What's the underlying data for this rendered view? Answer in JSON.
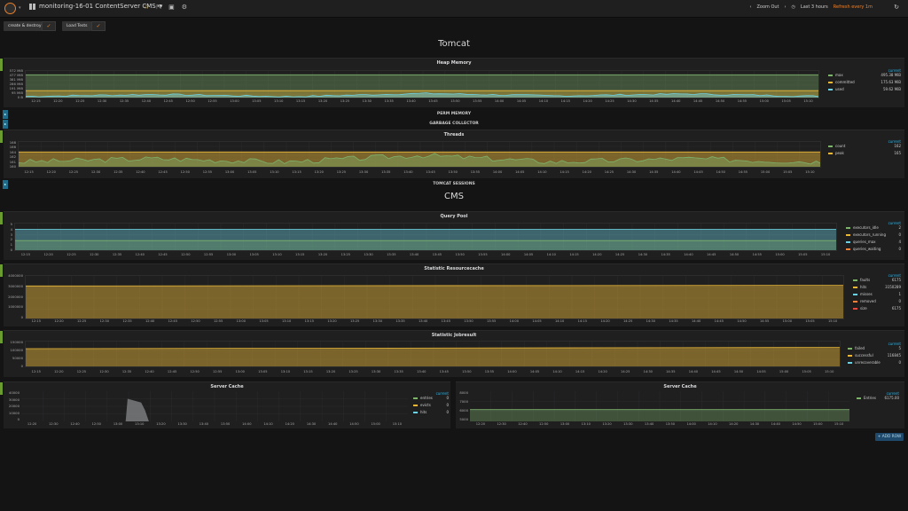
{
  "topbar": {
    "dashboard_title": "monitoring-16-01 ContentServer CMS",
    "title_caret": "▾",
    "logo_caret": "▾",
    "zoom_out": "Zoom Out",
    "time_range": "Last 3 hours",
    "refresh": "Refresh every 1m",
    "icons": [
      "dashboard-grid-icon",
      "star-icon",
      "share-icon",
      "save-icon",
      "settings-icon",
      "clock-icon",
      "refresh-icon"
    ]
  },
  "submenu": {
    "create_destroy": "create & destroy",
    "load_tests": "Load Tests"
  },
  "rows": {
    "tomcat": "Tomcat",
    "cms": "CMS",
    "perm_memory": "PERM MEMORY",
    "garbage_collector": "GARBAGE COLLECTOR",
    "tomcat_sessions": "TOMCAT SESSIONS",
    "add_row": "+ ADD ROW"
  },
  "panels": {
    "heap": {
      "title": "Heap Memory",
      "yticks": [
        "572 MiB",
        "477 MiB",
        "381 MiB",
        "286 MiB",
        "191 MiB",
        "95 MiB",
        "0 B"
      ],
      "xticks": [
        "12:15",
        "12:20",
        "12:25",
        "12:30",
        "12:35",
        "12:40",
        "12:45",
        "12:50",
        "12:55",
        "13:00",
        "13:05",
        "13:10",
        "13:15",
        "13:20",
        "13:25",
        "13:30",
        "13:35",
        "13:40",
        "13:45",
        "13:50",
        "13:55",
        "14:00",
        "14:05",
        "14:10",
        "14:15",
        "14:20",
        "14:25",
        "14:30",
        "14:35",
        "14:40",
        "14:45",
        "14:50",
        "14:55",
        "15:00",
        "15:05",
        "15:10"
      ],
      "legend_header": "current",
      "legend": [
        {
          "name": "max",
          "value": "495.38 MiB",
          "color": "#7eb26d"
        },
        {
          "name": "committed",
          "value": "175.63 MiB",
          "color": "#eab839"
        },
        {
          "name": "used",
          "value": "59.62 MiB",
          "color": "#6ed0e0"
        }
      ]
    },
    "threads": {
      "title": "Threads",
      "yticks": [
        "168",
        "166",
        "164",
        "162",
        "161",
        "160"
      ],
      "xticks": [
        "12:15",
        "12:20",
        "12:25",
        "12:30",
        "12:35",
        "12:40",
        "12:45",
        "12:50",
        "12:55",
        "13:00",
        "13:05",
        "13:10",
        "13:15",
        "13:20",
        "13:25",
        "13:30",
        "13:35",
        "13:40",
        "13:45",
        "13:50",
        "13:55",
        "14:00",
        "14:05",
        "14:10",
        "14:15",
        "14:20",
        "14:25",
        "14:30",
        "14:35",
        "14:40",
        "14:45",
        "14:50",
        "14:55",
        "15:00",
        "15:05",
        "15:10"
      ],
      "legend_header": "current",
      "legend": [
        {
          "name": "count",
          "value": "162",
          "color": "#7eb26d"
        },
        {
          "name": "peak",
          "value": "165",
          "color": "#eab839"
        }
      ]
    },
    "query_pool": {
      "title": "Query Pool",
      "yticks": [
        "5",
        "4",
        "3",
        "2",
        "1",
        "0"
      ],
      "xticks": [
        "12:15",
        "12:20",
        "12:25",
        "12:30",
        "12:35",
        "12:40",
        "12:45",
        "12:50",
        "12:55",
        "13:00",
        "13:05",
        "13:10",
        "13:15",
        "13:20",
        "13:25",
        "13:30",
        "13:35",
        "13:40",
        "13:45",
        "13:50",
        "13:55",
        "14:00",
        "14:05",
        "14:10",
        "14:15",
        "14:20",
        "14:25",
        "14:30",
        "14:35",
        "14:40",
        "14:45",
        "14:50",
        "14:55",
        "15:00",
        "15:05",
        "15:10"
      ],
      "legend_header": "current",
      "legend": [
        {
          "name": "executors_idle",
          "value": "2",
          "color": "#7eb26d"
        },
        {
          "name": "executors_running",
          "value": "0",
          "color": "#eab839"
        },
        {
          "name": "queries_max",
          "value": "4",
          "color": "#6ed0e0"
        },
        {
          "name": "queries_waiting",
          "value": "0",
          "color": "#ef843c"
        }
      ]
    },
    "resourcecache": {
      "title": "Statistic Resourcecache",
      "yticks": [
        "4000000",
        "3000000",
        "2000000",
        "1000000",
        "0"
      ],
      "xticks": [
        "12:15",
        "12:20",
        "12:25",
        "12:30",
        "12:35",
        "12:40",
        "12:45",
        "12:50",
        "12:55",
        "13:00",
        "13:05",
        "13:10",
        "13:15",
        "13:20",
        "13:25",
        "13:30",
        "13:35",
        "13:40",
        "13:45",
        "13:50",
        "13:55",
        "14:00",
        "14:05",
        "14:10",
        "14:15",
        "14:20",
        "14:25",
        "14:30",
        "14:35",
        "14:40",
        "14:45",
        "14:50",
        "14:55",
        "15:00",
        "15:05",
        "15:10"
      ],
      "legend_header": "current",
      "legend": [
        {
          "name": "faults",
          "value": "6175",
          "color": "#7eb26d"
        },
        {
          "name": "hits",
          "value": "3150289",
          "color": "#eab839"
        },
        {
          "name": "misses",
          "value": "1",
          "color": "#6ed0e0"
        },
        {
          "name": "removed",
          "value": "0",
          "color": "#ef843c"
        },
        {
          "name": "size",
          "value": "6175",
          "color": "#e24d42"
        }
      ]
    },
    "jobresult": {
      "title": "Statistic Jobresult",
      "yticks": [
        "150000",
        "100000",
        "50000",
        "0"
      ],
      "xticks": [
        "12:15",
        "12:20",
        "12:25",
        "12:30",
        "12:35",
        "12:40",
        "12:45",
        "12:50",
        "12:55",
        "13:00",
        "13:05",
        "13:10",
        "13:15",
        "13:20",
        "13:25",
        "13:30",
        "13:35",
        "13:40",
        "13:45",
        "13:50",
        "13:55",
        "14:00",
        "14:05",
        "14:10",
        "14:15",
        "14:20",
        "14:25",
        "14:30",
        "14:35",
        "14:40",
        "14:45",
        "14:50",
        "14:55",
        "15:00",
        "15:05",
        "15:10"
      ],
      "legend_header": "current",
      "legend": [
        {
          "name": "failed",
          "value": "5",
          "color": "#7eb26d"
        },
        {
          "name": "successful",
          "value": "116845",
          "color": "#eab839"
        },
        {
          "name": "unrecoverable",
          "value": "0",
          "color": "#6ed0e0"
        }
      ]
    },
    "cache_left": {
      "title": "Server Cache",
      "yticks": [
        "40000",
        "30000",
        "20000",
        "10000",
        "0"
      ],
      "xticks": [
        "12:20",
        "12:30",
        "12:40",
        "12:50",
        "13:00",
        "13:10",
        "13:20",
        "13:30",
        "13:40",
        "13:50",
        "14:00",
        "14:10",
        "14:20",
        "14:30",
        "14:40",
        "14:50",
        "15:00",
        "15:10"
      ],
      "legend_header": "current",
      "legend": [
        {
          "name": "entries",
          "value": "0",
          "color": "#7eb26d"
        },
        {
          "name": "evicts",
          "value": "0",
          "color": "#eab839"
        },
        {
          "name": "hits",
          "value": "0",
          "color": "#6ed0e0"
        }
      ]
    },
    "cache_right": {
      "title": "Server Cache",
      "yticks": [
        "8000",
        "7000",
        "6000",
        "5000"
      ],
      "xticks": [
        "12:20",
        "12:30",
        "12:40",
        "12:50",
        "13:00",
        "13:10",
        "13:20",
        "13:30",
        "13:40",
        "13:50",
        "14:00",
        "14:10",
        "14:20",
        "14:30",
        "14:40",
        "14:50",
        "15:00",
        "15:10"
      ],
      "legend_header": "current",
      "legend": [
        {
          "name": "Entries",
          "value": "6175.00",
          "color": "#7eb26d"
        }
      ]
    }
  },
  "chart_data": [
    {
      "type": "area",
      "title": "Heap Memory",
      "x_range": [
        "12:13",
        "15:12"
      ],
      "y_unit": "MiB",
      "ylim": [
        0,
        572
      ],
      "series": [
        {
          "name": "max",
          "values": [
            495.38,
            495.38
          ]
        },
        {
          "name": "committed",
          "values": [
            175.63,
            175.63
          ]
        },
        {
          "name": "used",
          "values": [
            60,
            100,
            55,
            120,
            70,
            110,
            59.62
          ]
        }
      ]
    },
    {
      "type": "area",
      "title": "Threads",
      "x_range": [
        "12:13",
        "15:12"
      ],
      "ylim": [
        160,
        168
      ],
      "series": [
        {
          "name": "count",
          "values": [
            162,
            163,
            162,
            164,
            162,
            163,
            162
          ]
        },
        {
          "name": "peak",
          "values": [
            165,
            165,
            165,
            165,
            165,
            165,
            165
          ]
        }
      ]
    },
    {
      "type": "area",
      "title": "Query Pool",
      "ylim": [
        0,
        5
      ],
      "series": [
        {
          "name": "executors_idle",
          "values": [
            2,
            2
          ]
        },
        {
          "name": "executors_running",
          "values": [
            0,
            0
          ]
        },
        {
          "name": "queries_max",
          "values": [
            4,
            4
          ]
        },
        {
          "name": "queries_waiting",
          "values": [
            0,
            0
          ]
        }
      ]
    },
    {
      "type": "area",
      "title": "Statistic Resourcecache",
      "ylim": [
        0,
        4000000
      ],
      "series": [
        {
          "name": "hits",
          "values": [
            3100000,
            3150289
          ]
        },
        {
          "name": "faults",
          "values": [
            6175,
            6175
          ]
        },
        {
          "name": "size",
          "values": [
            6175,
            6175
          ]
        }
      ]
    },
    {
      "type": "area",
      "title": "Statistic Jobresult",
      "ylim": [
        0,
        150000
      ],
      "series": [
        {
          "name": "successful",
          "values": [
            110000,
            116845
          ]
        },
        {
          "name": "failed",
          "values": [
            5,
            5
          ]
        }
      ]
    },
    {
      "type": "area",
      "title": "Server Cache",
      "ylim": [
        0,
        40000
      ],
      "series": [
        {
          "name": "hits",
          "x": [
            "12:13",
            "13:02",
            "13:03",
            "13:10",
            "13:12",
            "13:13",
            "15:12"
          ],
          "values": [
            0,
            0,
            30000,
            25000,
            15000,
            0,
            0
          ]
        }
      ]
    },
    {
      "type": "area",
      "title": "Server Cache",
      "ylim": [
        5000,
        8000
      ],
      "series": [
        {
          "name": "Entries",
          "values": [
            6175,
            6175
          ]
        }
      ]
    }
  ]
}
